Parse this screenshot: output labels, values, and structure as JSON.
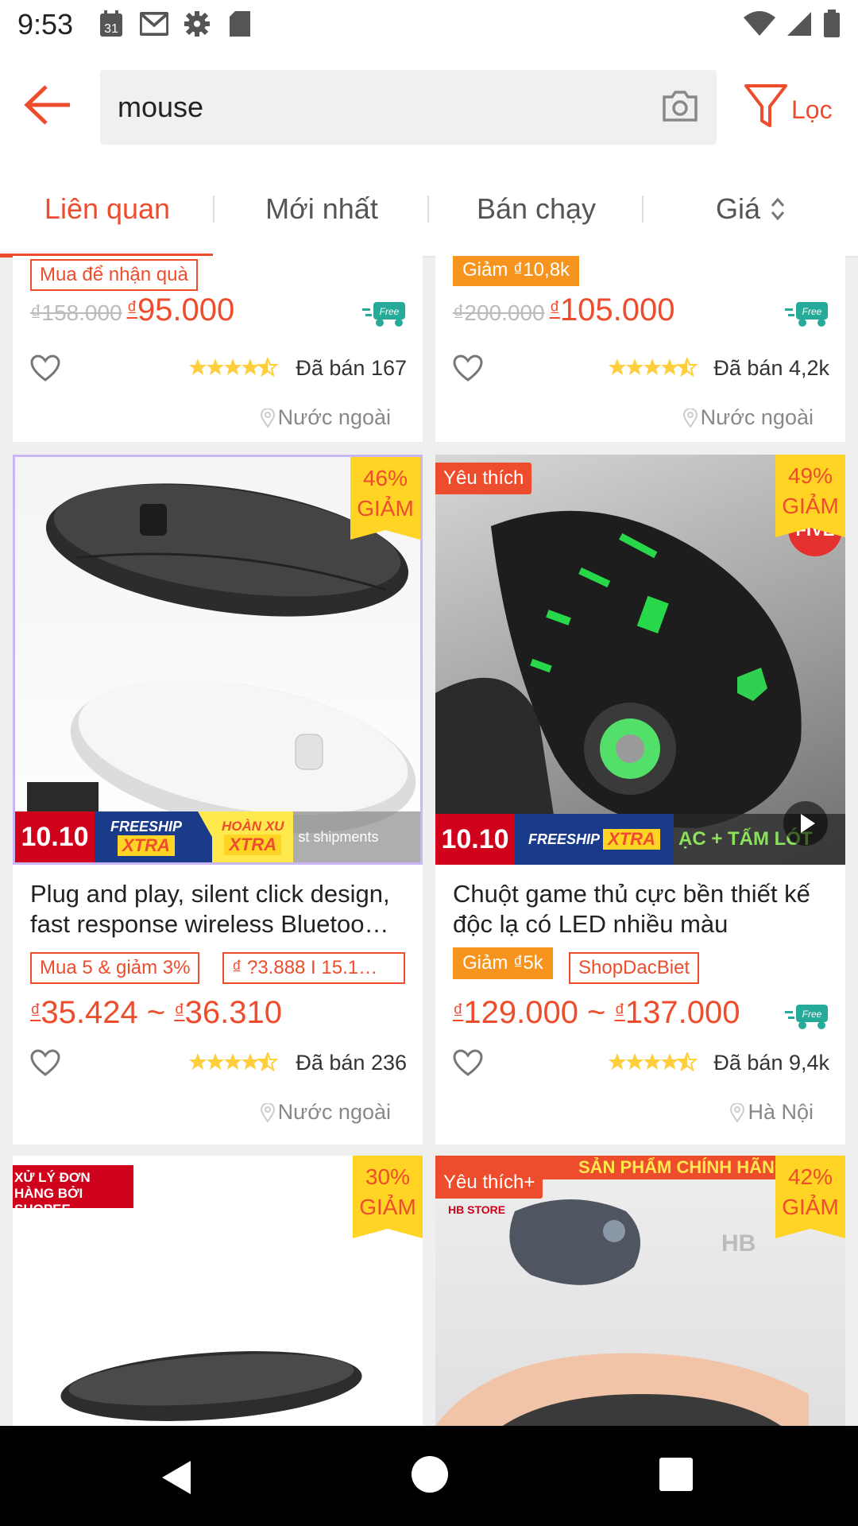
{
  "status": {
    "time": "9:53",
    "calendar_day": "31"
  },
  "search": {
    "query": "mouse",
    "filter_label": "Lọc"
  },
  "tabs": [
    "Liên quan",
    "Mới nhất",
    "Bán chạy",
    "Giá"
  ],
  "products": [
    {
      "chip1": "Mua để nhận quà",
      "old_price": "₫158.000",
      "price": "95.000",
      "sold": "Đã bán 167",
      "location": "Nước ngoài"
    },
    {
      "chip1": "Giảm ₫10,8k",
      "old_price": "₫200.000",
      "price": "105.000",
      "sold": "Đã bán 4,2k",
      "location": "Nước ngoài"
    },
    {
      "discount_pct": "46%",
      "discount_word": "GIẢM",
      "banner_1010": "10.10",
      "freeship": "FREESHIP",
      "xtra": "XTRA",
      "hoanxu": "HOÀN XU",
      "overlay_text": "st shipments",
      "title": " Plug and play, silent click design, fast response wireless Bluetoo…",
      "chip1": "Mua 5 & giảm 3%",
      "chip2": "₫ ?3.888 I 15.1…",
      "price_min": "35.424",
      "price_sep": " ~ ",
      "price_max": "36.310",
      "sold": "Đã bán 236",
      "location": "Nước ngoài"
    },
    {
      "fav": "Yêu thích",
      "discount_pct": "49%",
      "discount_word": "GIẢM",
      "banner_1010": "10.10",
      "freeship": "FREESHIP",
      "xtra": "XTRA",
      "overlay_text": "ẠC + TẤM LÓT",
      "title": " Chuột game thủ cực bền thiết kế độc lạ có LED nhiều màu",
      "chip1": "Giảm ₫5k",
      "chip2": "ShopDacBiet",
      "price_min": "129.000",
      "price_sep": " ~ ",
      "price_max": "137.000",
      "sold": "Đã bán 9,4k",
      "location": "Hà Nội"
    },
    {
      "shopee_tag": "XỬ LÝ ĐƠN HÀNG BỞI SHOPEE",
      "discount_pct": "30%",
      "discount_word": "GIẢM"
    },
    {
      "fav": "Yêu thích+",
      "discount_pct": "42%",
      "discount_word": "GIẢM",
      "promo_text": "SẢN PHẨM CHÍNH HÃNG",
      "store": "HB STORE"
    }
  ],
  "currency": "₫",
  "colors": {
    "accent": "#ee4d2d",
    "star": "#ffce3d",
    "discount_bg": "#ffd424"
  }
}
